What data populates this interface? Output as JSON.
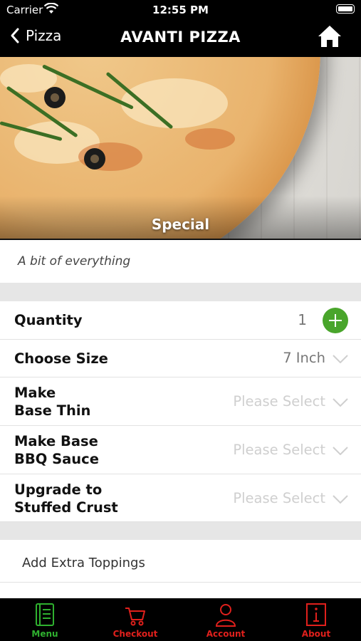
{
  "status_bar": {
    "carrier": "Carrier",
    "time": "12:55 PM"
  },
  "nav": {
    "back_label": "Pizza",
    "title": "AVANTI PIZZA"
  },
  "hero": {
    "caption": "Special"
  },
  "description": "A bit of everything",
  "options": {
    "quantity": {
      "label": "Quantity",
      "value": "1"
    },
    "size": {
      "label": "Choose Size",
      "value": "7 Inch"
    },
    "thin_base": {
      "label_line1": "Make",
      "label_line2": "Base Thin",
      "value": "Please Select"
    },
    "bbq_base": {
      "label_line1": "Make Base",
      "label_line2": "BBQ Sauce",
      "value": "Please Select"
    },
    "stuffed_crust": {
      "label_line1": "Upgrade to",
      "label_line2": "Stuffed Crust",
      "value": "Please Select"
    }
  },
  "extra_toppings": {
    "label": "Add Extra Toppings"
  },
  "tabbar": {
    "menu": "Menu",
    "checkout": "Checkout",
    "account": "Account",
    "about": "About"
  },
  "colors": {
    "accent_green": "#49a52b",
    "tab_active": "#2fb12f",
    "tab_inactive": "#e0201c"
  }
}
